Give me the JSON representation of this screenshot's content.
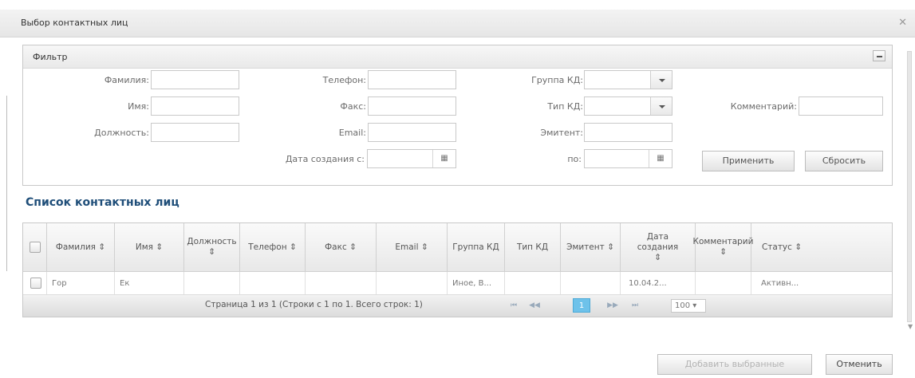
{
  "dialog": {
    "title": "Выбор контактных лиц",
    "close_icon": "close-icon"
  },
  "filter": {
    "title": "Фильтр",
    "collapse_icon": "minus-icon",
    "fields": {
      "surname": "Фамилия:",
      "name": "Имя:",
      "position": "Должность:",
      "phone": "Телефон:",
      "fax": "Факс:",
      "email": "Email:",
      "created_from": "Дата создания с:",
      "group": "Группа КД:",
      "type": "Тип КД:",
      "issuer": "Эмитент:",
      "created_to": "по:",
      "comment": "Комментарий:"
    },
    "values": {
      "surname": "",
      "name": "",
      "position": "",
      "phone": "",
      "fax": "",
      "email": "",
      "created_from": "",
      "group": "",
      "type": "",
      "issuer": "",
      "created_to": "",
      "comment": ""
    },
    "apply_label": "Применить",
    "reset_label": "Сбросить",
    "calendar_icon": "calendar-icon"
  },
  "list": {
    "title": "Список контактных лиц",
    "columns": [
      "Фамилия ⇕",
      "Имя ⇕",
      "Должность ⇕",
      "Телефон ⇕",
      "Факс ⇕",
      "Email ⇕",
      "Группа КД",
      "Тип КД",
      "Эмитент ⇕",
      "Дата создания ⇕",
      "Комментарий ⇕",
      "Статус ⇕"
    ],
    "rows": [
      [
        "Гор",
        "Ек",
        "",
        "",
        "",
        "",
        "Иное, В...",
        "",
        "",
        "10.04.2...",
        "",
        "Активн..."
      ]
    ],
    "pager": {
      "text": "Страница 1 из 1 (Строки с 1 по 1. Всего строк: 1)",
      "first": "⏮",
      "prev": "◀◀",
      "current": "1",
      "next": "▶▶",
      "last": "⏭",
      "page_size": "100 ▾"
    }
  },
  "footer": {
    "add_selected": "Добавить выбранные",
    "cancel": "Отменить"
  }
}
